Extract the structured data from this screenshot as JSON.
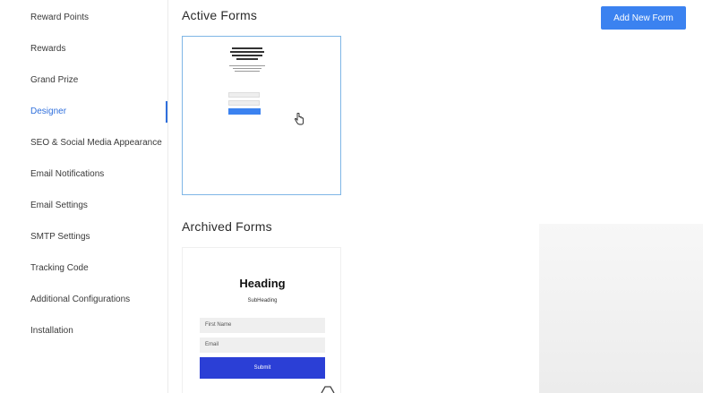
{
  "sidebar": {
    "items": [
      {
        "label": "Reward Points"
      },
      {
        "label": "Rewards"
      },
      {
        "label": "Grand Prize"
      },
      {
        "label": "Designer"
      },
      {
        "label": "SEO & Social Media Appearance"
      },
      {
        "label": "Email Notifications"
      },
      {
        "label": "Email Settings"
      },
      {
        "label": "SMTP Settings"
      },
      {
        "label": "Tracking Code"
      },
      {
        "label": "Additional Configurations"
      },
      {
        "label": "Installation"
      }
    ],
    "active_label": "Designer"
  },
  "main": {
    "active_title": "Active Forms",
    "archived_title": "Archived Forms",
    "add_button_label": "Add New Form",
    "archived_form": {
      "heading": "Heading",
      "subheading": "SubHeading",
      "first_name_placeholder": "First Name",
      "email_placeholder": "Email",
      "submit_label": "Submit"
    }
  },
  "colors": {
    "accent": "#3b82f0",
    "submit": "#2b3fd6",
    "active_nav": "#2f6fdc"
  }
}
